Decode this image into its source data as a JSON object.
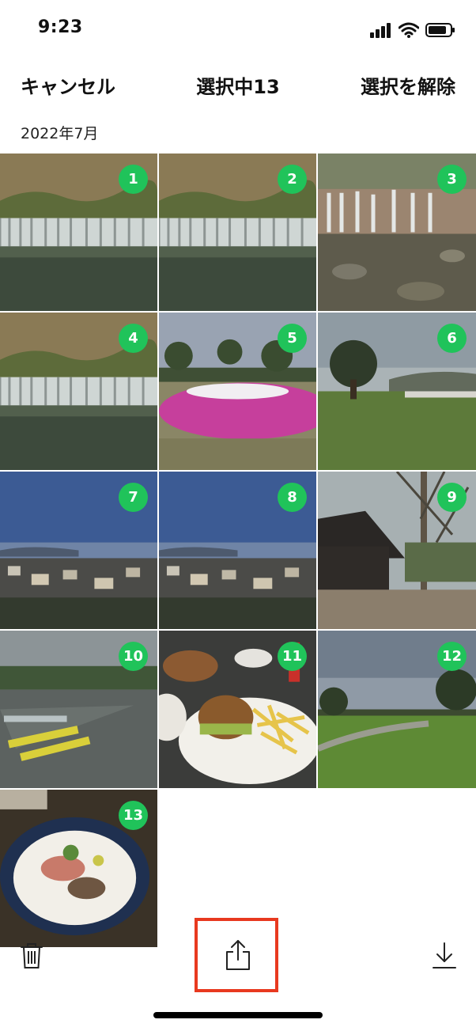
{
  "status_bar": {
    "time": "9:23"
  },
  "header": {
    "cancel_label": "キャンセル",
    "title": "選択中13",
    "clear_label": "選択を解除"
  },
  "section": {
    "date": "2022年7月"
  },
  "photos": [
    {
      "badge": "1",
      "scene": "waterfall-pond"
    },
    {
      "badge": "2",
      "scene": "waterfall-pond"
    },
    {
      "badge": "3",
      "scene": "waterfall-rocks"
    },
    {
      "badge": "4",
      "scene": "waterfall-pond"
    },
    {
      "badge": "5",
      "scene": "flower-park"
    },
    {
      "badge": "6",
      "scene": "meadow-tree"
    },
    {
      "badge": "7",
      "scene": "town-bay"
    },
    {
      "badge": "8",
      "scene": "town-bay"
    },
    {
      "badge": "9",
      "scene": "cabin-deck"
    },
    {
      "badge": "10",
      "scene": "boats-lake"
    },
    {
      "badge": "11",
      "scene": "burger-fries"
    },
    {
      "badge": "12",
      "scene": "lawn-trees"
    },
    {
      "badge": "13",
      "scene": "plated-dish"
    }
  ],
  "toolbar": {
    "delete_icon": "trash-icon",
    "share_icon": "share-icon",
    "download_icon": "download-icon"
  },
  "colors": {
    "badge": "#20c35a",
    "highlight": "#e8391f"
  }
}
